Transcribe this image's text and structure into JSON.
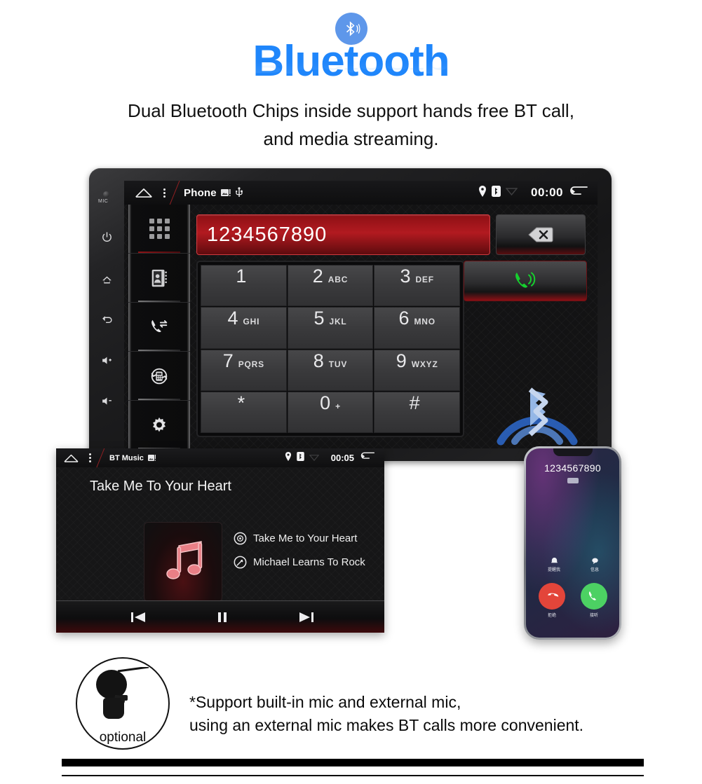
{
  "header": {
    "bt_icon": "bluetooth-icon",
    "title": "Bluetooth",
    "subtitle_line1": "Dual Bluetooth Chips inside support  hands free BT call,",
    "subtitle_line2": "and media streaming.",
    "accent_blue": "#1f86fb",
    "badge_blue": "#5e97ea"
  },
  "headunit": {
    "mic_label": "MIC",
    "hardware_buttons": [
      {
        "name": "power-button",
        "icon": "power-icon"
      },
      {
        "name": "home-button",
        "icon": "home-icon"
      },
      {
        "name": "back-button",
        "icon": "back-arrow-icon"
      },
      {
        "name": "volume-up-button",
        "icon": "speaker-plus-icon"
      },
      {
        "name": "volume-down-button",
        "icon": "speaker-minus-icon"
      }
    ],
    "statusbar": {
      "home_icon": "home-icon",
      "menu_icon": "kebab-menu-icon",
      "app_title": "Phone",
      "app_icons": [
        "image-icon",
        "usb-icon"
      ],
      "tray_icons": [
        "location-pin-icon",
        "bluetooth-icon",
        "wifi-icon"
      ],
      "clock": "00:00",
      "back_icon": "back-arrow-icon"
    },
    "sidenav": [
      {
        "name": "sidebar-item-keypad",
        "icon": "grid-keypad-icon",
        "active": true
      },
      {
        "name": "sidebar-item-contacts",
        "icon": "contacts-book-icon",
        "active": false
      },
      {
        "name": "sidebar-item-call-log",
        "icon": "call-transfer-icon",
        "active": false
      },
      {
        "name": "sidebar-item-sync",
        "icon": "sync-phonebook-icon",
        "active": false
      },
      {
        "name": "sidebar-item-settings",
        "icon": "gear-icon",
        "active": false
      }
    ],
    "dialer": {
      "number": "1234567890",
      "delete_icon": "backspace-icon",
      "call_icon": "phone-call-icon",
      "keys": [
        {
          "digit": "1",
          "letters": ""
        },
        {
          "digit": "2",
          "letters": "ABC"
        },
        {
          "digit": "3",
          "letters": "DEF"
        },
        {
          "digit": "4",
          "letters": "GHI"
        },
        {
          "digit": "5",
          "letters": "JKL"
        },
        {
          "digit": "6",
          "letters": "MNO"
        },
        {
          "digit": "7",
          "letters": "PQRS"
        },
        {
          "digit": "8",
          "letters": "TUV"
        },
        {
          "digit": "9",
          "letters": "WXYZ"
        },
        {
          "digit": "*",
          "letters": ""
        },
        {
          "digit": "0",
          "letters": "+"
        },
        {
          "digit": "#",
          "letters": ""
        }
      ]
    },
    "watermark_icon": "bluetooth-signal-watermark"
  },
  "btmusic": {
    "statusbar": {
      "home_icon": "home-icon",
      "menu_icon": "kebab-menu-icon",
      "app_title": "BT Music",
      "app_icons": [
        "image-icon"
      ],
      "tray_icons": [
        "location-pin-icon",
        "bluetooth-icon",
        "wifi-icon"
      ],
      "clock": "00:05",
      "back_icon": "back-arrow-icon"
    },
    "song_title": "Take Me To Your Heart",
    "album_art_icon": "music-note-icon",
    "track_name": "Take Me to Your Heart",
    "track_icon": "disc-icon",
    "artist_name": "Michael Learns To Rock",
    "artist_icon": "artist-icon",
    "controls": [
      {
        "name": "previous-track-button",
        "icon": "previous-icon"
      },
      {
        "name": "play-pause-button",
        "icon": "pause-icon"
      },
      {
        "name": "next-track-button",
        "icon": "next-icon"
      }
    ]
  },
  "phone": {
    "caller_number": "1234567890",
    "option_left_icon": "remind-icon",
    "option_left_label": "提醒我",
    "option_right_icon": "message-icon",
    "option_right_label": "信息",
    "decline_icon": "decline-call-icon",
    "decline_label": "拒绝",
    "accept_icon": "accept-call-icon",
    "accept_label": "接听",
    "decline_color": "#e3453a",
    "accept_color": "#4cd163"
  },
  "footer": {
    "mic_icon": "external-microphone-icon",
    "optional_label": "optional",
    "note_line1": "*Support built-in mic and external mic,",
    "note_line2": "using an external mic makes BT calls more convenient."
  }
}
